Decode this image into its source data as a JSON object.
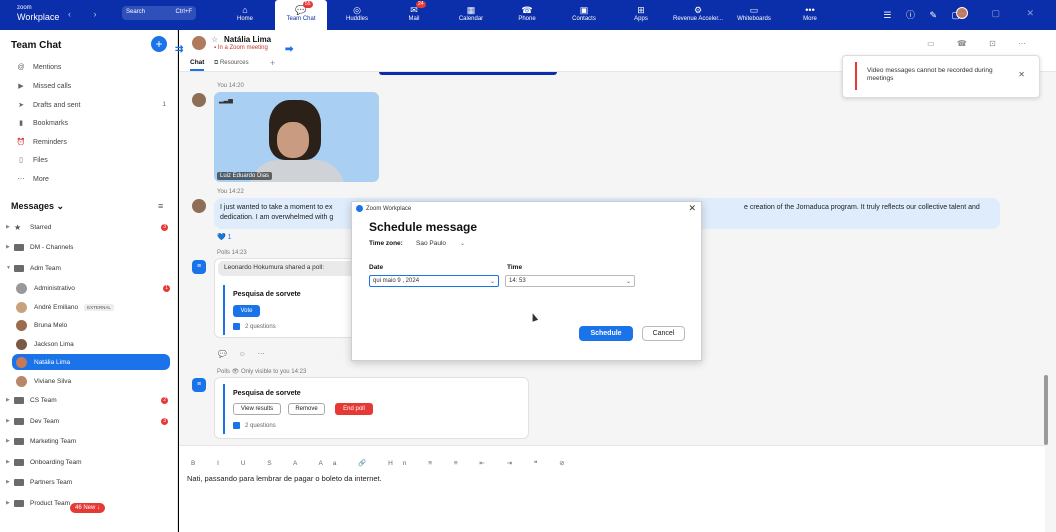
{
  "app": {
    "logo_small": "zoom",
    "logo_big": "Workplace",
    "nav_arrows": "‹ ›"
  },
  "search": {
    "label": "Search",
    "shortcut": "Ctrl+F"
  },
  "nav": [
    {
      "label": "Home",
      "icon": "⌂",
      "badge": ""
    },
    {
      "label": "Team Chat",
      "icon": "💬",
      "badge": "55"
    },
    {
      "label": "Huddles",
      "icon": "◎",
      "badge": ""
    },
    {
      "label": "Mail",
      "icon": "✉",
      "badge": "24"
    },
    {
      "label": "Calendar",
      "icon": "▦",
      "badge": ""
    },
    {
      "label": "Phone",
      "icon": "☎",
      "badge": ""
    },
    {
      "label": "Contacts",
      "icon": "▣",
      "badge": ""
    },
    {
      "label": "Apps",
      "icon": "⊞",
      "badge": ""
    },
    {
      "label": "Revenue Acceler...",
      "icon": "⚙",
      "badge": ""
    },
    {
      "label": "Whiteboards",
      "icon": "▭",
      "badge": ""
    },
    {
      "label": "More",
      "icon": "•••",
      "badge": ""
    }
  ],
  "top_icons": "☰ ⓘ ✎ ▢",
  "window_controls": "— ▢ ✕",
  "sidebar": {
    "title": "Team Chat",
    "items": [
      {
        "label": "Mentions",
        "icon": "@",
        "count": ""
      },
      {
        "label": "Missed calls",
        "icon": "▶",
        "count": ""
      },
      {
        "label": "Drafts and sent",
        "icon": "➤",
        "count": "1"
      },
      {
        "label": "Bookmarks",
        "icon": "▮",
        "count": ""
      },
      {
        "label": "Reminders",
        "icon": "⏰",
        "count": ""
      },
      {
        "label": "Files",
        "icon": "▯",
        "count": ""
      },
      {
        "label": "More",
        "icon": "⋯",
        "count": ""
      }
    ],
    "messages_title": "Messages ⌄",
    "tree_top": [
      {
        "label": "Starred",
        "badge": "3",
        "icon": "★"
      },
      {
        "label": "DM - Channels",
        "badge": "",
        "icon": ""
      },
      {
        "label": "Adm Team",
        "badge": "",
        "icon": ""
      }
    ],
    "people": [
      {
        "label": "Administrativo",
        "badge": "1",
        "ext": ""
      },
      {
        "label": "André Emiliano",
        "badge": "",
        "ext": "EXTERNAL"
      },
      {
        "label": "Bruna Melo",
        "badge": "",
        "ext": ""
      },
      {
        "label": "Jackson Lima",
        "badge": "",
        "ext": ""
      },
      {
        "label": "Natália Lima",
        "badge": "",
        "ext": ""
      },
      {
        "label": "Viviane Silva",
        "badge": "",
        "ext": ""
      }
    ],
    "tree_bottom": [
      {
        "label": "CS Team",
        "badge": "2"
      },
      {
        "label": "Dev Team",
        "badge": "3"
      },
      {
        "label": "Marketing Team",
        "badge": ""
      },
      {
        "label": "Onboarding Team",
        "badge": ""
      },
      {
        "label": "Partners Team",
        "badge": ""
      },
      {
        "label": "Product Team",
        "badge": ""
      }
    ],
    "new_pill": "46 New ↓"
  },
  "chat": {
    "name": "Natália Lima",
    "status": "In a Zoom meeting",
    "tab_chat": "Chat",
    "tab_resources": "Resources",
    "tab_add": "+",
    "head_icons": "▭ ☎ ⊡ ⋯",
    "msg1_time": "You 14:20",
    "video_name": "Luiz Eduardo Dias",
    "msg2_time": "You 14:22",
    "msg2_line1_a": "I just wanted to take a moment to ex",
    "msg2_line1_b": "e creation of the Jornaduca program. It truly reflects our collective talent and",
    "msg2_line2": "dedication. I am overwhelmed with g",
    "reaction": "💙 1",
    "poll1_time": "Polls 14:23",
    "poll_shared": "Leonardo Hokumura shared a poll:",
    "poll_title": "Pesquisa de sorvete",
    "vote": "Vote",
    "questions": "2 questions",
    "poll2_time": "Polls 👁 Only visible to you 14:23",
    "view_results": "View results",
    "remove": "Remove",
    "end_poll": "End poll",
    "msg_actions": "💬 ☺ ⋯"
  },
  "composer": {
    "toolbar": "B I U S A Aa 🔗 Hn ≡ ≡ ⇤ ⇥ ❝ ⊘",
    "text": "Nati, passando para lembrar de pagar o boleto da internet."
  },
  "toast": {
    "text": "Video messages cannot be recorded during meetings"
  },
  "dialog": {
    "app": "Zoom Workplace",
    "title": "Schedule message",
    "timezone_label": "Time zone:",
    "timezone_value": "Sao Paulo",
    "date_label": "Date",
    "date_value": "qui   maio  9 , 2024",
    "time_label": "Time",
    "time_value": "14: 53",
    "schedule": "Schedule",
    "cancel": "Cancel"
  },
  "colors": {
    "topbar": "#0b2eaa",
    "accent": "#1a73e8",
    "danger": "#e53935",
    "bubble": "#deecfb"
  }
}
